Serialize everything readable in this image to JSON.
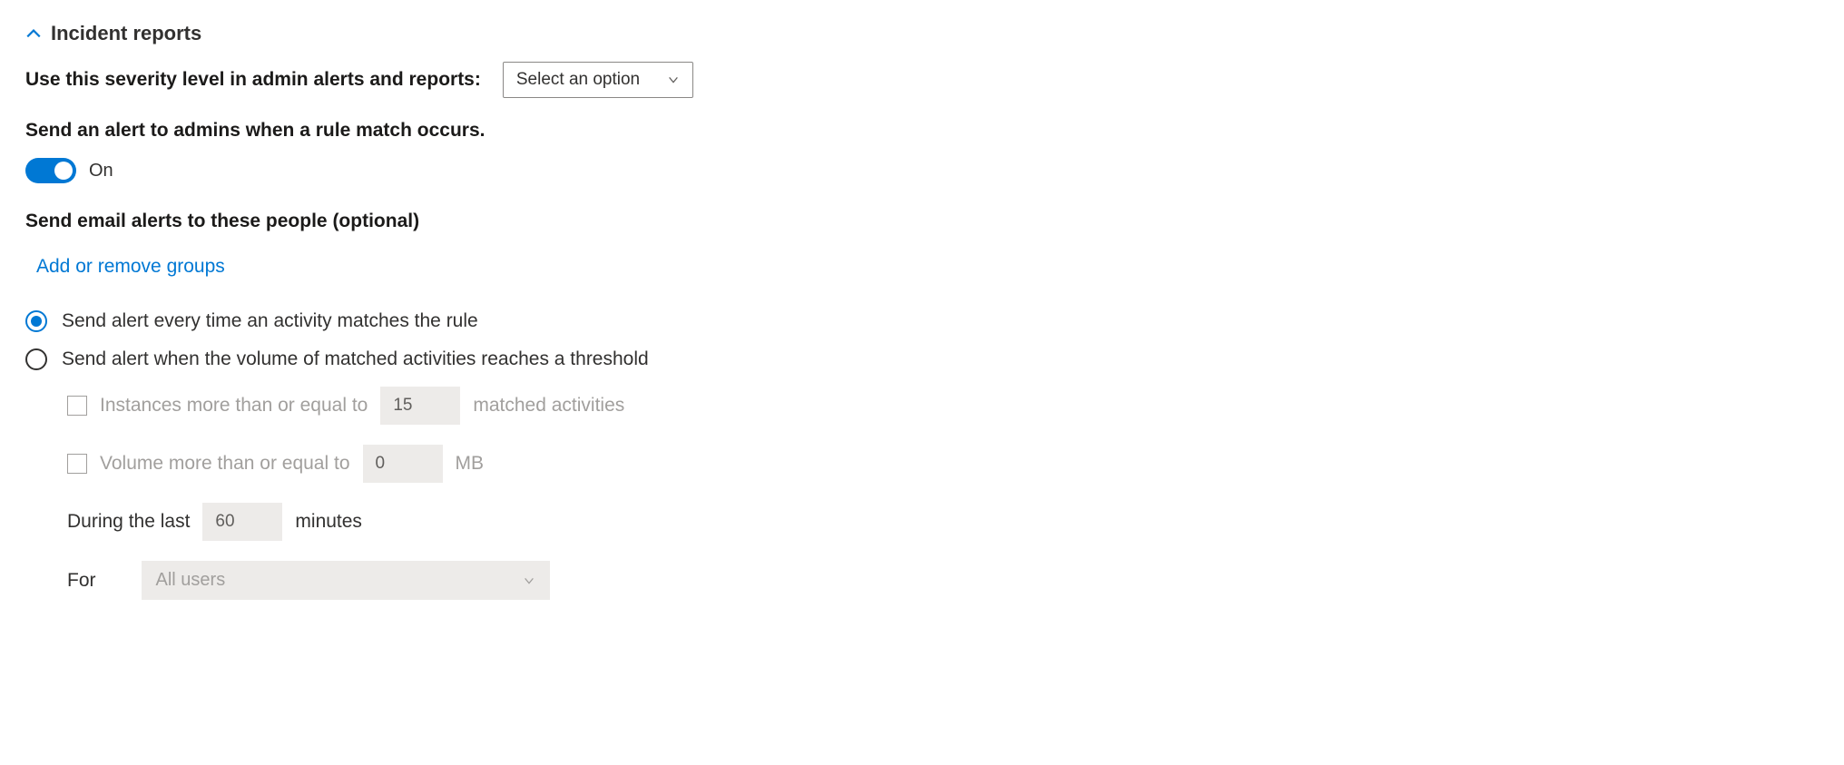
{
  "section": {
    "title": "Incident reports"
  },
  "severity": {
    "label": "Use this severity level in admin alerts and reports:",
    "dropdown_placeholder": "Select an option"
  },
  "alert_toggle": {
    "label": "Send an alert to admins when a rule match occurs.",
    "state": "On"
  },
  "email_alerts": {
    "label": "Send email alerts to these people (optional)",
    "link": "Add or remove groups"
  },
  "radio": {
    "option1": "Send alert every time an activity matches the rule",
    "option2": "Send alert when the volume of matched activities reaches a threshold"
  },
  "threshold": {
    "instances_label": "Instances more than or equal to",
    "instances_value": "15",
    "instances_suffix": "matched activities",
    "volume_label": "Volume more than or equal to",
    "volume_value": "0",
    "volume_suffix": "MB",
    "during_label": "During the last",
    "during_value": "60",
    "during_suffix": "minutes",
    "for_label": "For",
    "for_value": "All users"
  }
}
